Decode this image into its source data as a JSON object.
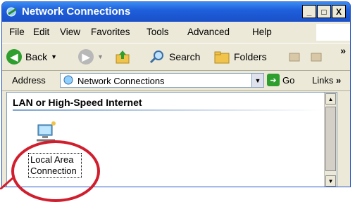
{
  "window": {
    "title": "Network Connections"
  },
  "title_buttons": {
    "minimize": "_",
    "maximize": "□",
    "close": "X"
  },
  "menu": [
    "File",
    "Edit",
    "View",
    "Favorites",
    "Tools",
    "Advanced",
    "Help"
  ],
  "toolbar": {
    "back_label": "Back",
    "search_label": "Search",
    "folders_label": "Folders",
    "chevron": "»"
  },
  "address": {
    "label": "Address",
    "value": "Network Connections",
    "go_label": "Go",
    "links_label": "Links",
    "chevron": "»"
  },
  "content": {
    "group_title": "LAN or High-Speed Internet",
    "items": [
      {
        "label_line1": "Local Area",
        "label_line2": "Connection"
      }
    ]
  },
  "colors": {
    "titlebar": "#1f5fdc",
    "chrome": "#ece9d8",
    "highlight_circle": "#d01e2e"
  }
}
